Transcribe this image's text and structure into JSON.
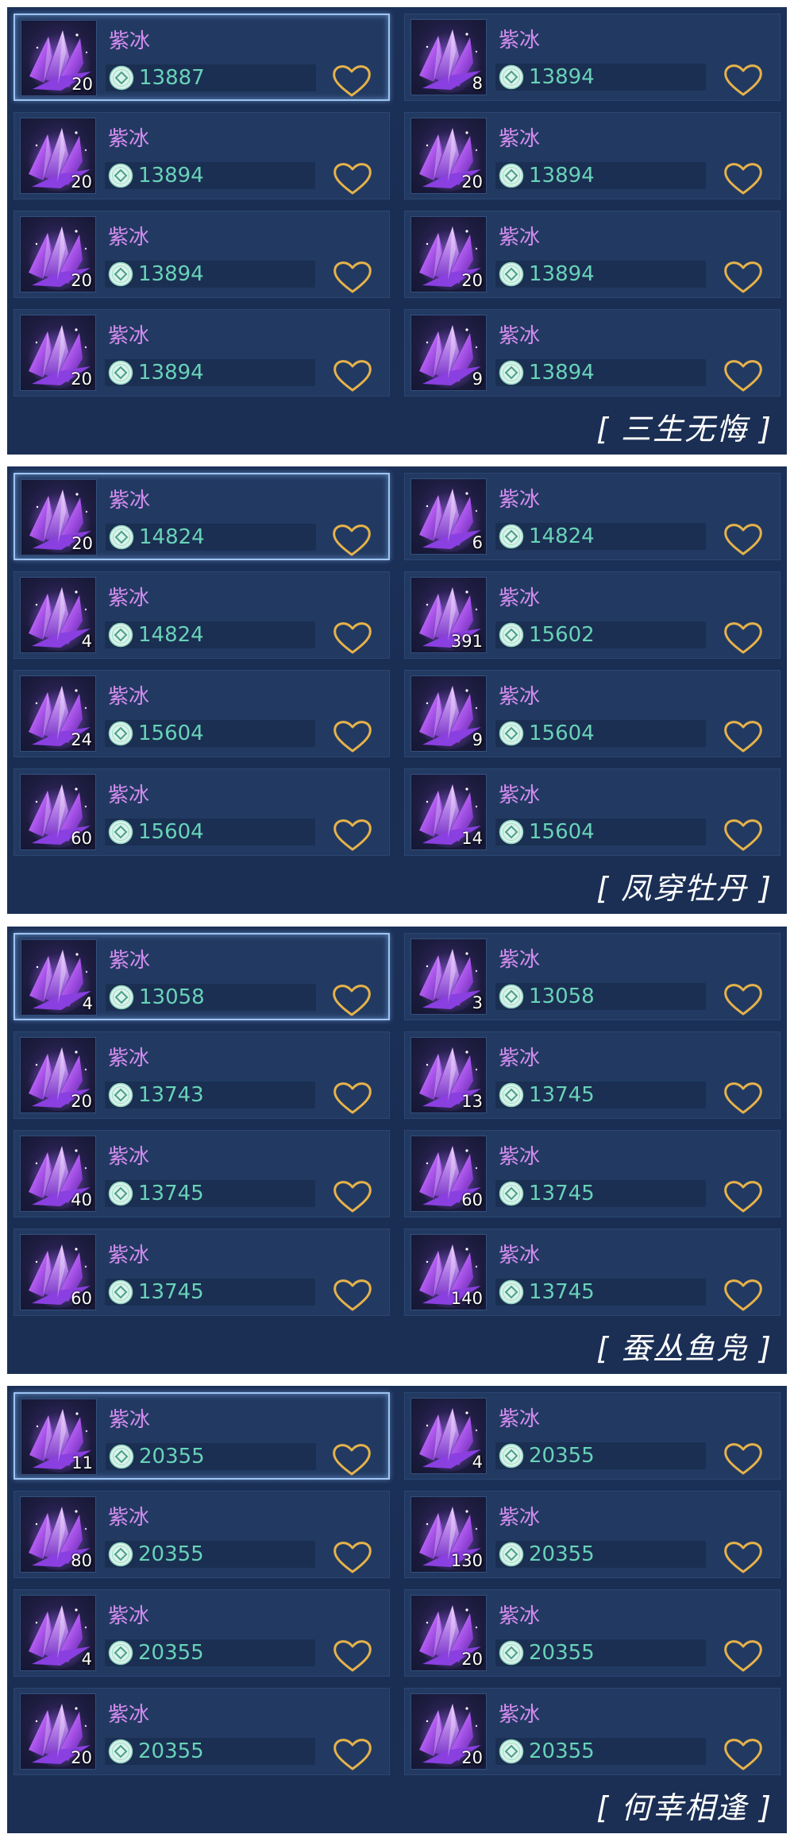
{
  "sections": [
    {
      "tag": "[ 三生无悔 ]",
      "items": [
        {
          "name": "紫冰",
          "qty": "20",
          "price": "13887",
          "selected": true
        },
        {
          "name": "紫冰",
          "qty": "8",
          "price": "13894"
        },
        {
          "name": "紫冰",
          "qty": "20",
          "price": "13894"
        },
        {
          "name": "紫冰",
          "qty": "20",
          "price": "13894"
        },
        {
          "name": "紫冰",
          "qty": "20",
          "price": "13894"
        },
        {
          "name": "紫冰",
          "qty": "20",
          "price": "13894"
        },
        {
          "name": "紫冰",
          "qty": "20",
          "price": "13894"
        },
        {
          "name": "紫冰",
          "qty": "9",
          "price": "13894"
        }
      ]
    },
    {
      "tag": "[ 凤穿牡丹 ]",
      "items": [
        {
          "name": "紫冰",
          "qty": "20",
          "price": "14824",
          "selected": true
        },
        {
          "name": "紫冰",
          "qty": "6",
          "price": "14824"
        },
        {
          "name": "紫冰",
          "qty": "4",
          "price": "14824"
        },
        {
          "name": "紫冰",
          "qty": "391",
          "price": "15602"
        },
        {
          "name": "紫冰",
          "qty": "24",
          "price": "15604"
        },
        {
          "name": "紫冰",
          "qty": "9",
          "price": "15604"
        },
        {
          "name": "紫冰",
          "qty": "60",
          "price": "15604"
        },
        {
          "name": "紫冰",
          "qty": "14",
          "price": "15604"
        }
      ]
    },
    {
      "tag": "[ 蚕丛鱼凫 ]",
      "items": [
        {
          "name": "紫冰",
          "qty": "4",
          "price": "13058",
          "selected": true
        },
        {
          "name": "紫冰",
          "qty": "3",
          "price": "13058"
        },
        {
          "name": "紫冰",
          "qty": "20",
          "price": "13743"
        },
        {
          "name": "紫冰",
          "qty": "13",
          "price": "13745"
        },
        {
          "name": "紫冰",
          "qty": "40",
          "price": "13745"
        },
        {
          "name": "紫冰",
          "qty": "60",
          "price": "13745"
        },
        {
          "name": "紫冰",
          "qty": "60",
          "price": "13745"
        },
        {
          "name": "紫冰",
          "qty": "140",
          "price": "13745"
        }
      ]
    },
    {
      "tag": "[ 何幸相逢 ]",
      "items": [
        {
          "name": "紫冰",
          "qty": "11",
          "price": "20355",
          "selected": true
        },
        {
          "name": "紫冰",
          "qty": "4",
          "price": "20355"
        },
        {
          "name": "紫冰",
          "qty": "80",
          "price": "20355"
        },
        {
          "name": "紫冰",
          "qty": "130",
          "price": "20355"
        },
        {
          "name": "紫冰",
          "qty": "4",
          "price": "20355"
        },
        {
          "name": "紫冰",
          "qty": "20",
          "price": "20355"
        },
        {
          "name": "紫冰",
          "qty": "20",
          "price": "20355"
        },
        {
          "name": "紫冰",
          "qty": "20",
          "price": "20355"
        }
      ]
    }
  ],
  "icons": {
    "item": "purple-crystal-icon",
    "currency": "coin-icon",
    "favorite": "heart-outline-icon"
  },
  "colors": {
    "panel_bg": "#1c3158",
    "item_name": "#d58df0",
    "price": "#69d2b8",
    "heart": "#e6b24a",
    "selected_border": "#9ec4f2"
  }
}
